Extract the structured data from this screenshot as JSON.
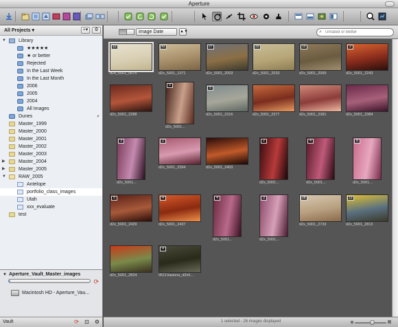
{
  "app": {
    "title": "Aperture"
  },
  "projects_panel": {
    "header": "All Projects",
    "tree": [
      {
        "label": "Library",
        "depth": 0,
        "icon": "library-icon",
        "expanded": true
      },
      {
        "label": "★★★★★",
        "depth": 1,
        "icon": "smart-album-icon"
      },
      {
        "label": "★ or better",
        "depth": 1,
        "icon": "smart-album-icon"
      },
      {
        "label": "Rejected",
        "depth": 1,
        "icon": "smart-album-icon"
      },
      {
        "label": "In the Last Week",
        "depth": 1,
        "icon": "smart-album-icon"
      },
      {
        "label": "In the Last Month",
        "depth": 1,
        "icon": "smart-album-icon"
      },
      {
        "label": "2006",
        "depth": 1,
        "icon": "smart-album-icon"
      },
      {
        "label": "2005",
        "depth": 1,
        "icon": "smart-album-icon"
      },
      {
        "label": "2004",
        "depth": 1,
        "icon": "smart-album-icon"
      },
      {
        "label": "All Images",
        "depth": 1,
        "icon": "smart-album-icon"
      },
      {
        "label": "Dunes",
        "depth": 0,
        "icon": "smart-album-icon",
        "search": true
      },
      {
        "label": "Master_1999",
        "depth": 0,
        "icon": "project-icon"
      },
      {
        "label": "Master_2000",
        "depth": 0,
        "icon": "project-icon"
      },
      {
        "label": "Master_2001",
        "depth": 0,
        "icon": "project-icon"
      },
      {
        "label": "Master_2002",
        "depth": 0,
        "icon": "project-icon"
      },
      {
        "label": "Master_2003",
        "depth": 0,
        "icon": "project-icon"
      },
      {
        "label": "Master_2004",
        "depth": 0,
        "icon": "project-icon",
        "collapsed": true
      },
      {
        "label": "Master_2005",
        "depth": 0,
        "icon": "project-icon",
        "collapsed": true
      },
      {
        "label": "RAW_2005",
        "depth": 0,
        "icon": "project-icon",
        "expanded": true
      },
      {
        "label": "Antelope",
        "depth": 1,
        "icon": "album-icon"
      },
      {
        "label": "portfolio_class_images",
        "depth": 1,
        "icon": "album-icon",
        "selected": true
      },
      {
        "label": "Utah",
        "depth": 1,
        "icon": "album-icon"
      },
      {
        "label": "xxx_evaluate",
        "depth": 1,
        "icon": "album-icon"
      },
      {
        "label": "test",
        "depth": 0,
        "icon": "project-icon"
      }
    ]
  },
  "vault_panel": {
    "name": "Aperture_Vault_Master_images",
    "progress": 0.02,
    "drive": "Macintosh HD - Aperture_Vau..."
  },
  "bottom_left": {
    "label": "Vault"
  },
  "browser": {
    "sort_value": "Image Date",
    "filter_placeholder": "Unrated or Better",
    "status_text": "1 selected - 26 images displayed",
    "zoom_level": 0.55
  },
  "images": [
    {
      "label": "d2x_5001_0675",
      "badge": "12",
      "colors": [
        "#e8e2cf",
        "#d9cfb4",
        "#c2b690"
      ],
      "selected": true
    },
    {
      "label": "d2x_5001_1371",
      "badge": "43",
      "colors": [
        "#cdbb98",
        "#a88f6a",
        "#7b6547"
      ]
    },
    {
      "label": "d2x_5001_2003",
      "badge": "27",
      "colors": [
        "#6d7179",
        "#8c6f45",
        "#3d3a2e"
      ]
    },
    {
      "label": "d2x_5001_2033",
      "badge": "33",
      "colors": [
        "#c9bd97",
        "#b6a678",
        "#8f7f55"
      ]
    },
    {
      "label": "d2x_5001_2069",
      "badge": "15",
      "colors": [
        "#8c7a5a",
        "#6b5b40",
        "#9f8e6d"
      ]
    },
    {
      "label": "d2x_5001_2243",
      "badge": "2",
      "colors": [
        "#d9642f",
        "#8a2c1d",
        "#2a0f0a"
      ]
    },
    {
      "label": "d2x_5001_2288",
      "badge": "",
      "colors": [
        "#6a2a1f",
        "#b4553a",
        "#2b1410"
      ]
    },
    {
      "label": "d2x_5001...",
      "badge": "5",
      "colors": [
        "#402018",
        "#c9a08a",
        "#5a2c20"
      ]
    },
    {
      "label": "d2x_5001_2316",
      "badge": "5",
      "colors": [
        "#7f8b8d",
        "#a7a79a",
        "#5d6762"
      ]
    },
    {
      "label": "d2x_5001_2377",
      "badge": "",
      "colors": [
        "#c86a3d",
        "#7a2d1e",
        "#e89a62"
      ]
    },
    {
      "label": "d2x_5001_2381",
      "badge": "",
      "colors": [
        "#d28a7a",
        "#8c3c3a",
        "#f0b8a0"
      ]
    },
    {
      "label": "d2x_5001_2384",
      "badge": "",
      "colors": [
        "#6b2a4a",
        "#a8607a",
        "#3a1428"
      ]
    },
    {
      "label": "d2x_5001...",
      "badge": "3",
      "colors": [
        "#7a3a58",
        "#c58ab0",
        "#2a1020"
      ]
    },
    {
      "label": "d2x_5001_2394",
      "badge": "2",
      "colors": [
        "#a85a70",
        "#d89ab0",
        "#5a2030"
      ]
    },
    {
      "label": "d2x_5001_2403",
      "badge": "",
      "colors": [
        "#2a0c0a",
        "#c05a2a",
        "#1a0806"
      ]
    },
    {
      "label": "d2x_5001...",
      "badge": "2",
      "colors": [
        "#3a0c10",
        "#b83a3a",
        "#1a0608"
      ]
    },
    {
      "label": "d2x_5001...",
      "badge": "4",
      "colors": [
        "#5a1a2a",
        "#c05a7a",
        "#2a0a12"
      ]
    },
    {
      "label": "d2x_5001...",
      "badge": "8",
      "colors": [
        "#c86a8a",
        "#e8a8c0",
        "#7a2a4a"
      ]
    },
    {
      "label": "d2x_5001_2429",
      "badge": "5",
      "colors": [
        "#5a2018",
        "#a85a3a",
        "#2a0c08"
      ]
    },
    {
      "label": "d2x_5001_2437",
      "badge": "4",
      "colors": [
        "#d85a2a",
        "#8a2a10",
        "#f0904a"
      ]
    },
    {
      "label": "d2x_5001...",
      "badge": "4",
      "colors": [
        "#6a2a40",
        "#b86a8a",
        "#3a1020"
      ]
    },
    {
      "label": "d2x_5001...",
      "badge": "3",
      "colors": [
        "#8a4a6a",
        "#d8a0b8",
        "#4a1a30"
      ]
    },
    {
      "label": "d2x_5001_2733",
      "badge": "28",
      "colors": [
        "#d8c8b0",
        "#b8a080",
        "#8a6a4a"
      ]
    },
    {
      "label": "d2x_5001_2813",
      "badge": "13",
      "colors": [
        "#e0c030",
        "#5a7080",
        "#3a3a2a"
      ]
    },
    {
      "label": "d2x_5001_2824",
      "badge": "",
      "colors": [
        "#c83a1a",
        "#7a8a4a",
        "#3a3020"
      ]
    },
    {
      "label": "0511Vasiona_d2x0...",
      "badge": "4",
      "colors": [
        "#4a4a3a",
        "#2a2a1a",
        "#6a6a5a"
      ]
    }
  ],
  "toolbar": {
    "icons": [
      "import-icon",
      "new-project-icon",
      "new-album-icon",
      "new-smart-album-icon",
      "new-light-table-icon",
      "new-book-icon",
      "new-web-gallery-icon",
      "stack-icon",
      "unstack-icon",
      "select-rotate-left-icon",
      "rotate-left-icon",
      "rotate-right-icon",
      "pick-icon",
      "pointer-tool-icon",
      "rotate-tool-icon",
      "straighten-tool-icon",
      "crop-tool-icon",
      "red-eye-tool-icon",
      "spot-patch-tool-icon",
      "lift-stamp-tool-icon",
      "viewer-icon",
      "browser-icon",
      "light-table-icon",
      "inspector-icon",
      "loupe-icon",
      "hud-icon"
    ]
  }
}
